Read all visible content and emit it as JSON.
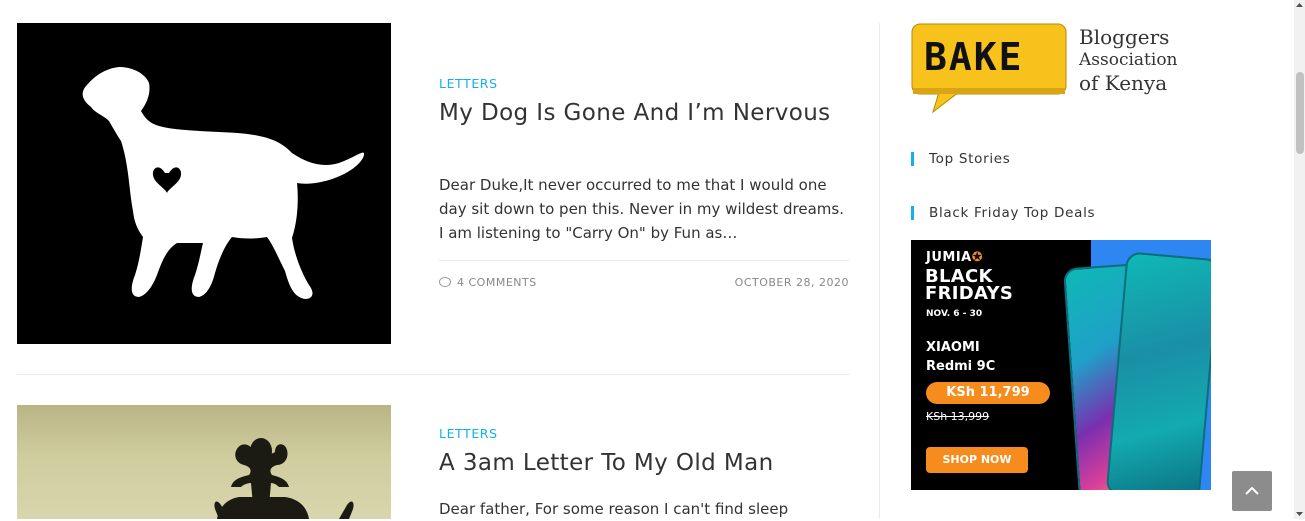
{
  "posts": [
    {
      "category": "LETTERS",
      "title": "My Dog Is Gone And I’m Nervous",
      "excerpt": "Dear Duke,It never occurred to me that I would one day sit down to pen this. Never in my wildest dreams. I am listening to \"Carry On\" by Fun as…",
      "comments": "4 COMMENTS",
      "date": "OCTOBER 28, 2020"
    },
    {
      "category": "LETTERS",
      "title": "A 3am Letter To My Old Man",
      "excerpt": "Dear father, For some reason I can't find sleep"
    }
  ],
  "sidebar": {
    "logo": {
      "badge_text": "BAKE",
      "line1": "Bloggers",
      "line2": "Association",
      "line3": "of Kenya"
    },
    "widgets": [
      {
        "title": "Top Stories"
      },
      {
        "title": "Black Friday Top Deals"
      }
    ],
    "ad": {
      "brand": "JUMIA",
      "headline_1": "BLACK",
      "headline_2": "FRIDAYS",
      "dates": "NOV. 6 - 30",
      "maker": "XIAOMI",
      "model": "Redmi 9C",
      "price": "KSh 11,799",
      "old_price": "KSh 13,999",
      "cta": "SHOP NOW"
    }
  },
  "colors": {
    "accent": "#13aff0",
    "jumia_orange": "#f68b1e",
    "ad_blue": "#2e86f2",
    "logo_yellow": "#f7c21c"
  },
  "icons": {
    "comments": "comment-icon",
    "scroll_top": "chevron-up-icon"
  }
}
